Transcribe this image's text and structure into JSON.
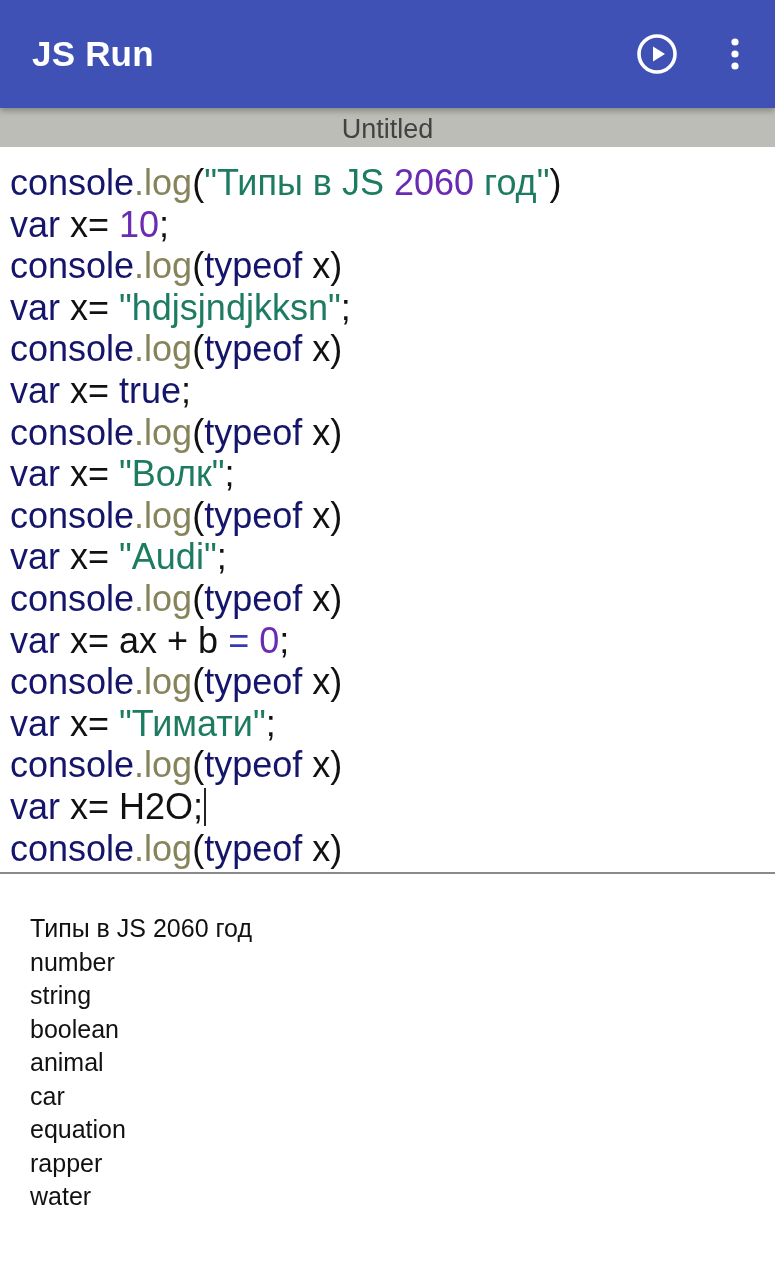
{
  "app_bar": {
    "title": "JS Run"
  },
  "document": {
    "title": "Untitled"
  },
  "editor": {
    "lines": [
      {
        "cursor": false,
        "tokens": [
          {
            "kind": "object",
            "text": "console"
          },
          {
            "kind": "method",
            "text": ".log"
          },
          {
            "kind": "punct",
            "text": "("
          },
          {
            "kind": "string",
            "text": "\"Типы в JS "
          },
          {
            "kind": "number",
            "text": "2060"
          },
          {
            "kind": "string",
            "text": " год\""
          },
          {
            "kind": "punct",
            "text": ")"
          }
        ]
      },
      {
        "cursor": false,
        "tokens": [
          {
            "kind": "keyword",
            "text": "var"
          },
          {
            "kind": "plain",
            "text": " x= "
          },
          {
            "kind": "number",
            "text": "10"
          },
          {
            "kind": "plain",
            "text": ";"
          }
        ]
      },
      {
        "cursor": false,
        "tokens": [
          {
            "kind": "object",
            "text": "console"
          },
          {
            "kind": "method",
            "text": ".log"
          },
          {
            "kind": "punct",
            "text": "("
          },
          {
            "kind": "keyword",
            "text": "typeof"
          },
          {
            "kind": "plain",
            "text": " x)"
          }
        ]
      },
      {
        "cursor": false,
        "tokens": [
          {
            "kind": "keyword",
            "text": "var"
          },
          {
            "kind": "plain",
            "text": " x= "
          },
          {
            "kind": "string",
            "text": "\"hdjsjndjkksn\""
          },
          {
            "kind": "plain",
            "text": ";"
          }
        ]
      },
      {
        "cursor": false,
        "tokens": [
          {
            "kind": "object",
            "text": "console"
          },
          {
            "kind": "method",
            "text": ".log"
          },
          {
            "kind": "punct",
            "text": "("
          },
          {
            "kind": "keyword",
            "text": "typeof"
          },
          {
            "kind": "plain",
            "text": " x)"
          }
        ]
      },
      {
        "cursor": false,
        "tokens": [
          {
            "kind": "keyword",
            "text": "var"
          },
          {
            "kind": "plain",
            "text": " x= "
          },
          {
            "kind": "keyword",
            "text": "true"
          },
          {
            "kind": "plain",
            "text": ";"
          }
        ]
      },
      {
        "cursor": false,
        "tokens": [
          {
            "kind": "object",
            "text": "console"
          },
          {
            "kind": "method",
            "text": ".log"
          },
          {
            "kind": "punct",
            "text": "("
          },
          {
            "kind": "keyword",
            "text": "typeof"
          },
          {
            "kind": "plain",
            "text": " x)"
          }
        ]
      },
      {
        "cursor": false,
        "tokens": [
          {
            "kind": "keyword",
            "text": "var"
          },
          {
            "kind": "plain",
            "text": " x= "
          },
          {
            "kind": "string",
            "text": "\"Волк\""
          },
          {
            "kind": "plain",
            "text": ";"
          }
        ]
      },
      {
        "cursor": false,
        "tokens": [
          {
            "kind": "object",
            "text": "console"
          },
          {
            "kind": "method",
            "text": ".log"
          },
          {
            "kind": "punct",
            "text": "("
          },
          {
            "kind": "keyword",
            "text": "typeof"
          },
          {
            "kind": "plain",
            "text": " x)"
          }
        ]
      },
      {
        "cursor": false,
        "tokens": [
          {
            "kind": "keyword",
            "text": "var"
          },
          {
            "kind": "plain",
            "text": " x= "
          },
          {
            "kind": "string",
            "text": "\"Audi\""
          },
          {
            "kind": "plain",
            "text": ";"
          }
        ]
      },
      {
        "cursor": false,
        "tokens": [
          {
            "kind": "object",
            "text": "console"
          },
          {
            "kind": "method",
            "text": ".log"
          },
          {
            "kind": "punct",
            "text": "("
          },
          {
            "kind": "keyword",
            "text": "typeof"
          },
          {
            "kind": "plain",
            "text": " x)"
          }
        ]
      },
      {
        "cursor": false,
        "tokens": [
          {
            "kind": "keyword",
            "text": "var"
          },
          {
            "kind": "plain",
            "text": " x= ax + b "
          },
          {
            "kind": "operator",
            "text": "= "
          },
          {
            "kind": "number",
            "text": "0"
          },
          {
            "kind": "plain",
            "text": ";"
          }
        ]
      },
      {
        "cursor": false,
        "tokens": [
          {
            "kind": "object",
            "text": "console"
          },
          {
            "kind": "method",
            "text": ".log"
          },
          {
            "kind": "punct",
            "text": "("
          },
          {
            "kind": "keyword",
            "text": "typeof"
          },
          {
            "kind": "plain",
            "text": " x)"
          }
        ]
      },
      {
        "cursor": false,
        "tokens": [
          {
            "kind": "keyword",
            "text": "var"
          },
          {
            "kind": "plain",
            "text": " x= "
          },
          {
            "kind": "string",
            "text": "\"Тимати\""
          },
          {
            "kind": "plain",
            "text": ";"
          }
        ]
      },
      {
        "cursor": false,
        "tokens": [
          {
            "kind": "object",
            "text": "console"
          },
          {
            "kind": "method",
            "text": ".log"
          },
          {
            "kind": "punct",
            "text": "("
          },
          {
            "kind": "keyword",
            "text": "typeof"
          },
          {
            "kind": "plain",
            "text": " x)"
          }
        ]
      },
      {
        "cursor": true,
        "tokens": [
          {
            "kind": "keyword",
            "text": "var"
          },
          {
            "kind": "plain",
            "text": " x= H2O;"
          }
        ]
      },
      {
        "cursor": false,
        "tokens": [
          {
            "kind": "object",
            "text": "console"
          },
          {
            "kind": "method",
            "text": ".log"
          },
          {
            "kind": "punct",
            "text": "("
          },
          {
            "kind": "keyword",
            "text": "typeof"
          },
          {
            "kind": "plain",
            "text": " x)"
          }
        ]
      }
    ]
  },
  "output": {
    "lines": [
      "Типы в JS 2060 год",
      "number",
      "string",
      "boolean",
      "animal",
      "car",
      "equation",
      "rapper",
      "water"
    ]
  }
}
